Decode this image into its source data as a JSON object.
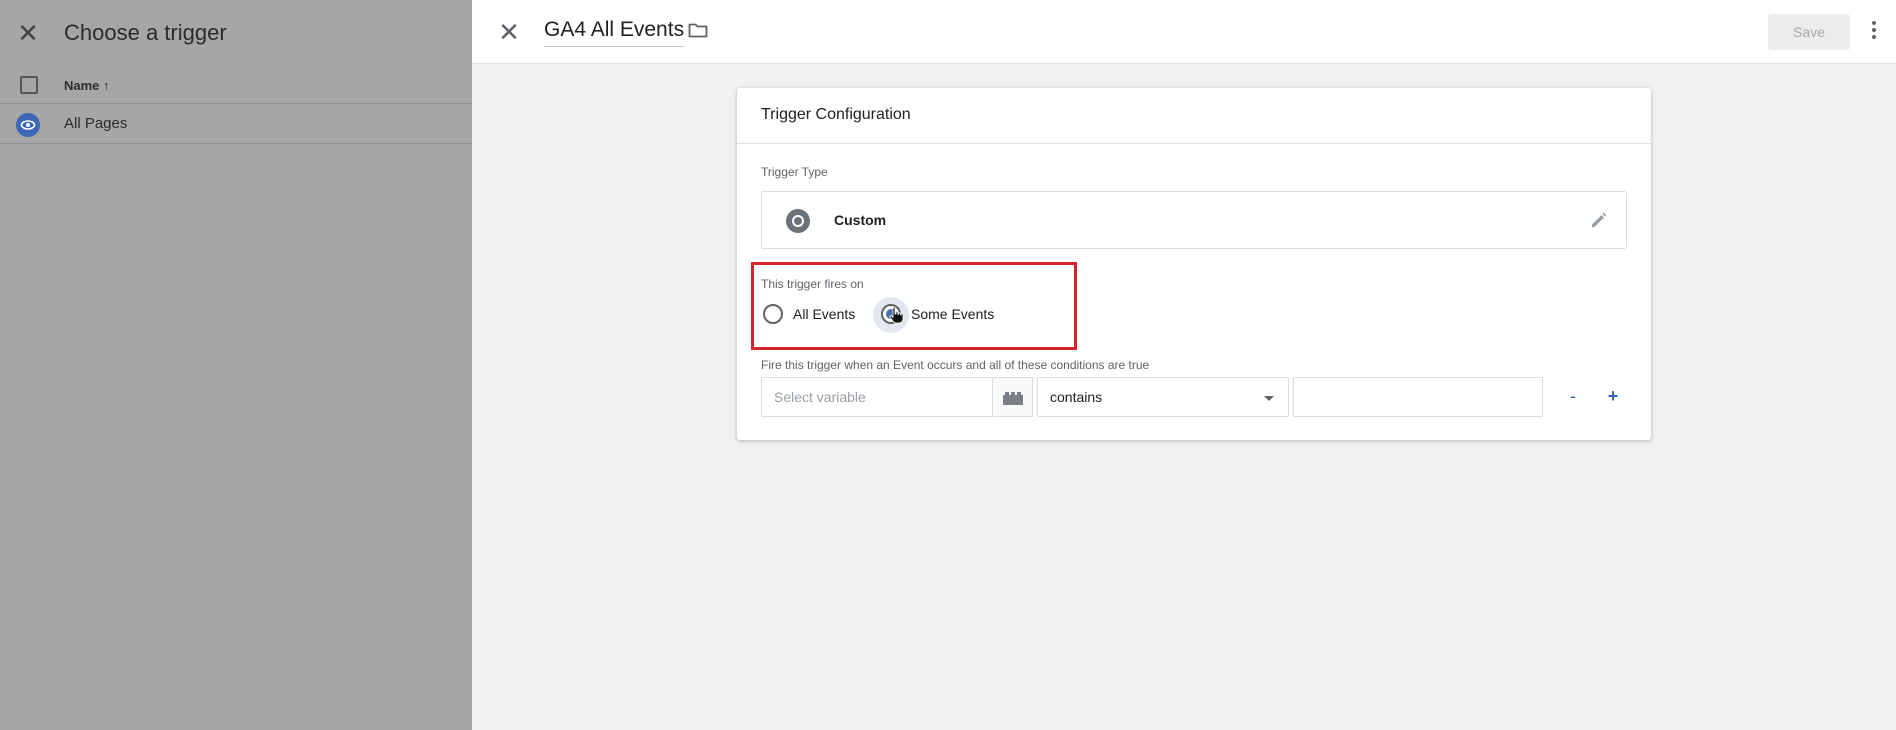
{
  "left_panel": {
    "title": "Choose a trigger",
    "column_header": "Name",
    "sort_icon": "arrow-up-icon",
    "rows": [
      {
        "label": "All Pages",
        "icon": "eye-icon"
      }
    ]
  },
  "right_panel": {
    "tag_name": "GA4 All Events",
    "save_label": "Save",
    "card": {
      "title": "Trigger Configuration",
      "trigger_type_label": "Trigger Type",
      "trigger_type_name": "Custom",
      "fires_on_label": "This trigger fires on",
      "option_all": "All Events",
      "option_some": "Some Events",
      "selected_option": "Some Events",
      "conditions_label": "Fire this trigger when an Event occurs and all of these conditions are true",
      "variable_placeholder": "Select variable",
      "operator_value": "contains",
      "condition_value": "",
      "remove_label": "-",
      "add_label": "+"
    }
  },
  "colors": {
    "accent": "#3b67b6",
    "highlight_border": "#d5232f",
    "overlay": "#a6a6a6"
  }
}
